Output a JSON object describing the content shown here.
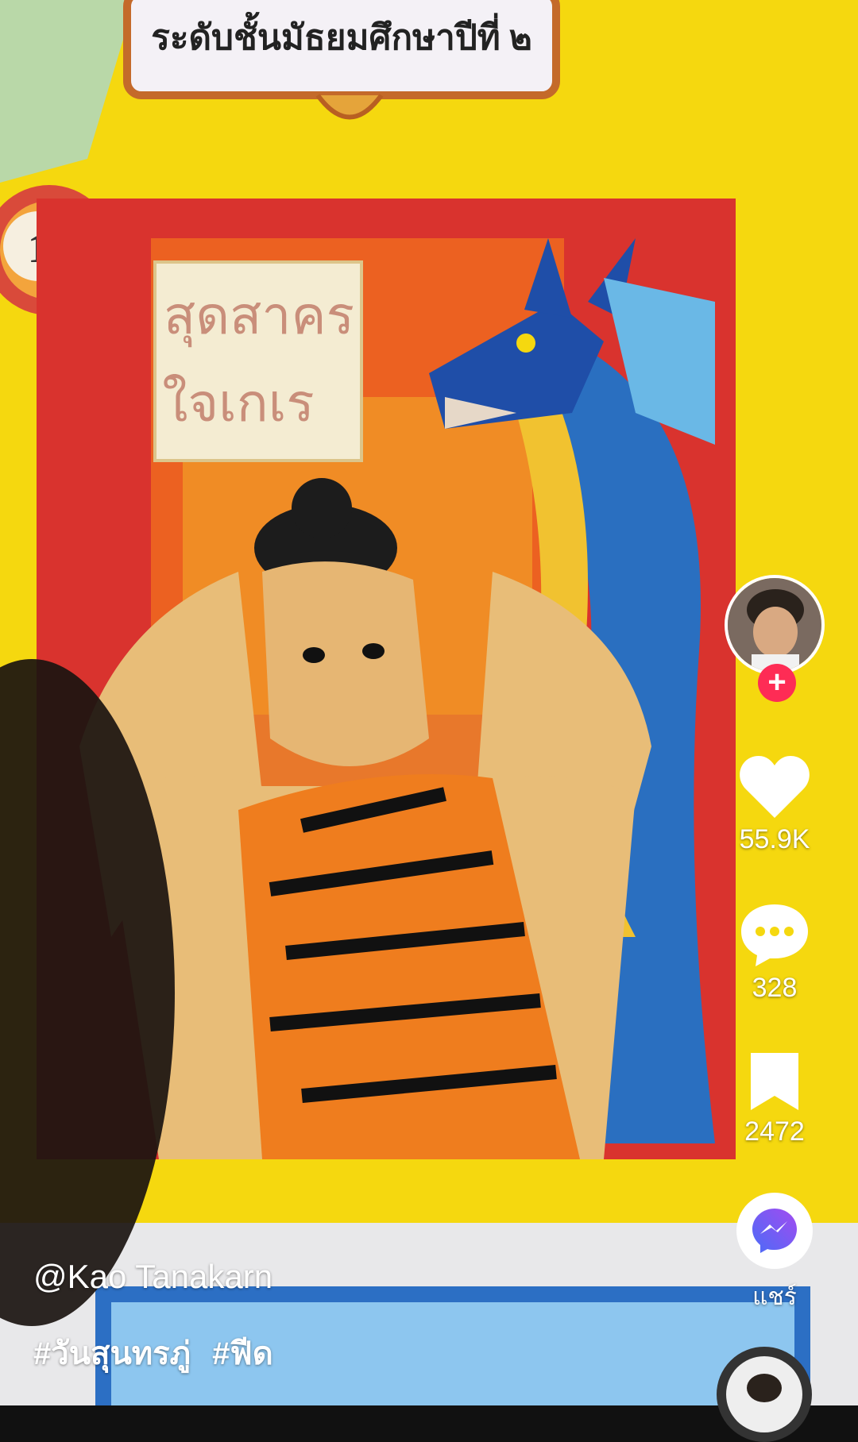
{
  "video": {
    "banner_text": "ระดับชั้นมัธยมศึกษาปีที่ ๒",
    "medal_number": "1",
    "poster_title_line1": "สุดสาคร",
    "poster_title_line2": "ใจเกเร"
  },
  "creator": {
    "username": "@Kao Tanakarn",
    "follow_symbol": "+"
  },
  "actions": {
    "likes": "55.9K",
    "comments": "328",
    "bookmarks": "2472",
    "share_label": "แชร์"
  },
  "post": {
    "hashtags": [
      "#วันสุนทรภู่",
      "#ฟีด"
    ]
  },
  "colors": {
    "follow_red": "#fe2c55",
    "messenger_blue": "#4a6cf7",
    "messenger_purple": "#a34bf0",
    "wall_yellow": "#f5d80f"
  },
  "icons": {
    "like": "heart-icon",
    "comment": "comment-bubble-icon",
    "bookmark": "bookmark-icon",
    "share": "messenger-icon"
  }
}
